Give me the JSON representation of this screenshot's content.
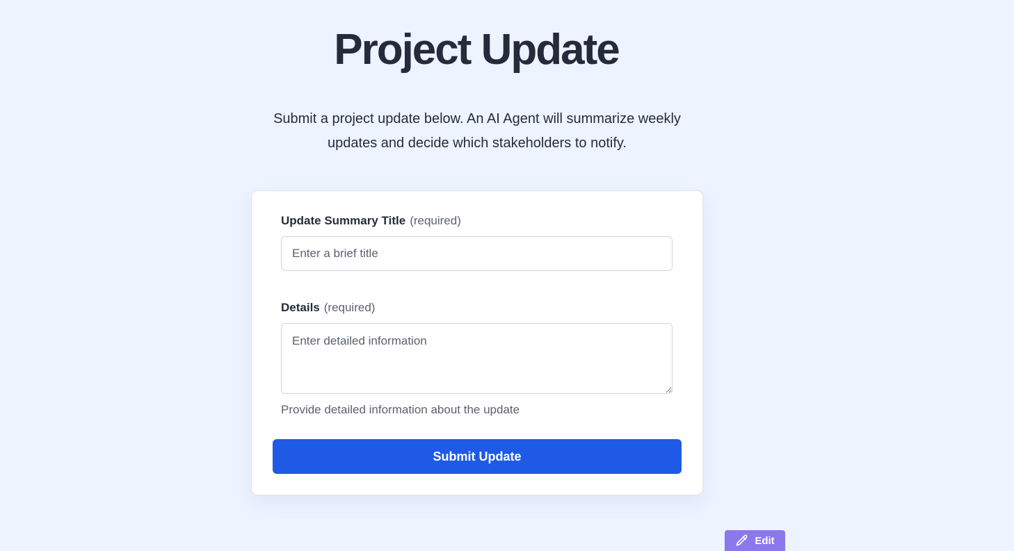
{
  "header": {
    "title": "Project Update",
    "intro": "Submit a project update below. An AI Agent will summarize weekly updates and decide which stakeholders to notify."
  },
  "form": {
    "title_field": {
      "label": "Update Summary Title",
      "required_note": "(required)",
      "placeholder": "Enter a brief title",
      "value": ""
    },
    "details_field": {
      "label": "Details",
      "required_note": "(required)",
      "placeholder": "Enter detailed information",
      "value": "",
      "help": "Provide detailed information about the update"
    },
    "submit_label": "Submit Update"
  },
  "edit_button": {
    "label": "Edit",
    "icon": "pencil-icon"
  },
  "colors": {
    "background": "#edf3ff",
    "primary": "#1f5ae6",
    "edit_accent": "#8b78ec",
    "text": "#262b3b",
    "muted": "#5b6170"
  }
}
